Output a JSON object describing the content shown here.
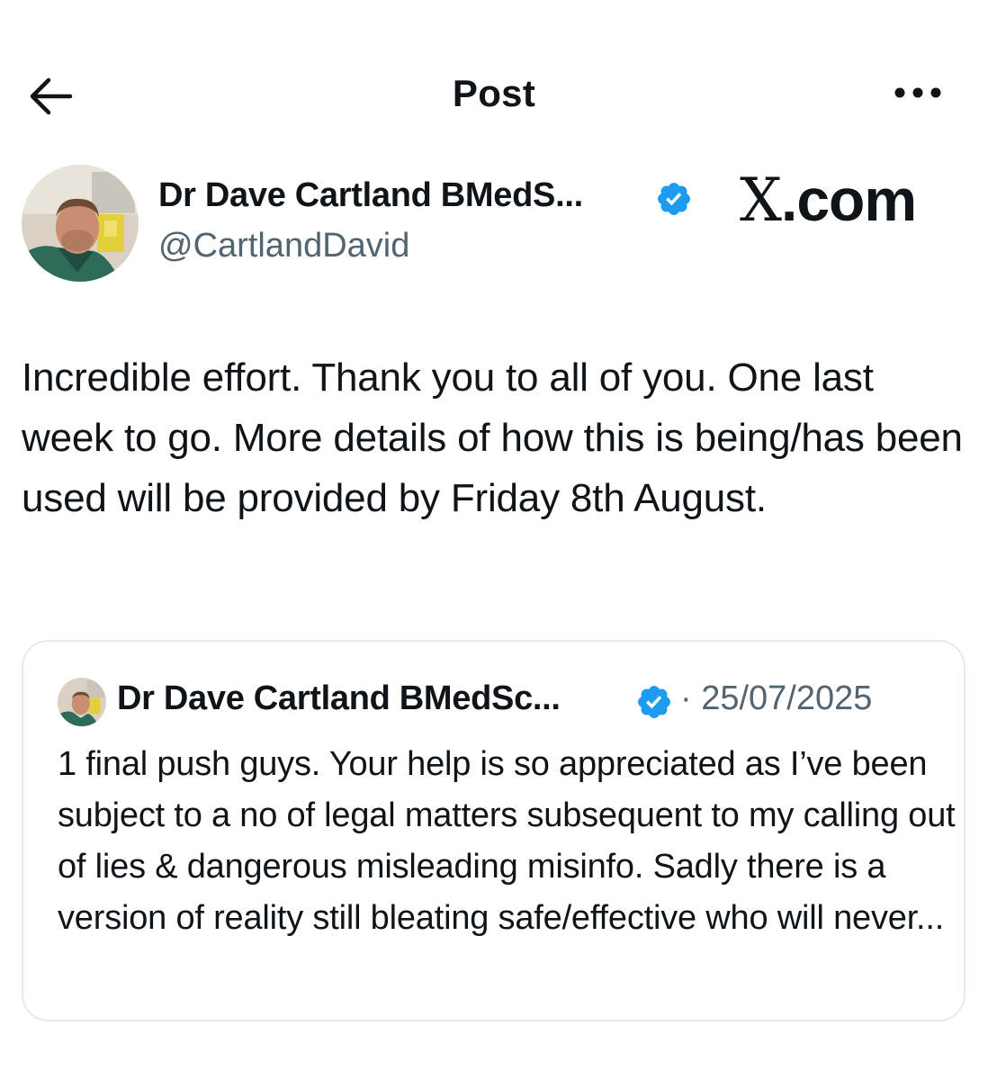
{
  "header": {
    "title": "Post",
    "back_icon": "arrow-left-icon",
    "more_icon": "more-horizontal-icon"
  },
  "post": {
    "author_name": "Dr Dave Cartland BMedS...",
    "author_handle": "@CartlandDavid",
    "verified": true,
    "watermark": {
      "x": "X",
      "rest": ".com"
    },
    "text": "Incredible effort. Thank you to all of you. One last week to go. More details of how this is being/has been used will be provided by Friday 8th August."
  },
  "quote": {
    "author_name": "Dr Dave Cartland BMedSc...",
    "verified": true,
    "date": "· 25/07/2025",
    "text": "1 final push guys. Your help is so appreciated as I’ve been subject to a no of legal matters subsequent to my calling out of lies & dangerous misleading misinfo. Sadly there is a version of reality still bleating safe/effective who will never..."
  },
  "colors": {
    "text": "#0f1419",
    "secondary": "#536471",
    "verified": "#1d9bf0",
    "border": "#e7e9ec"
  }
}
